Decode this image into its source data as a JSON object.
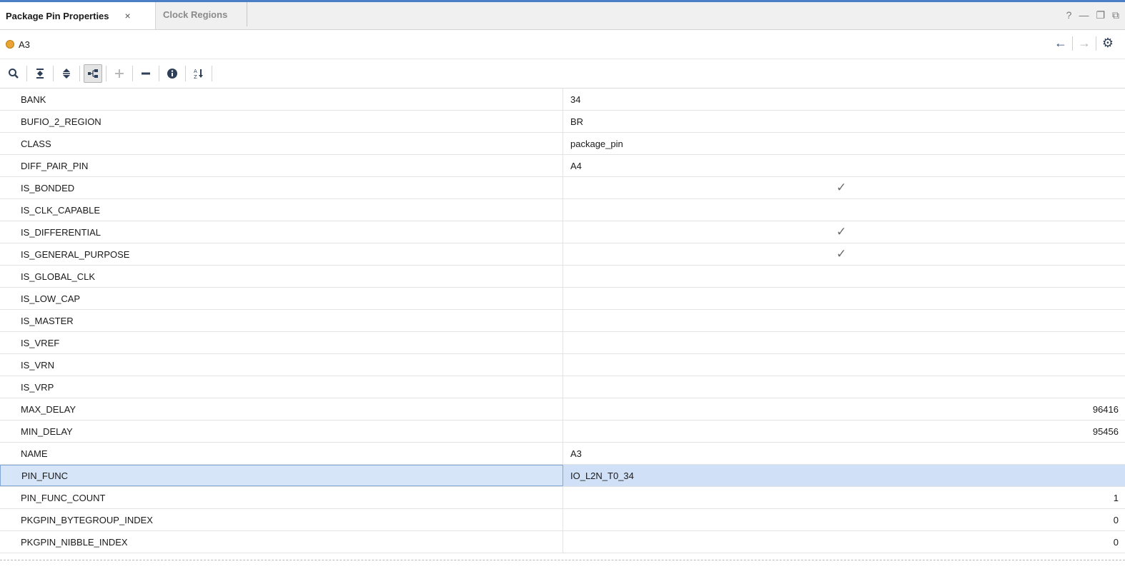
{
  "tabs": [
    {
      "label": "Package Pin Properties",
      "close": "×"
    },
    {
      "label": "Clock Regions"
    }
  ],
  "window_controls": [
    "?",
    "—",
    "❐",
    "⧉"
  ],
  "object": {
    "name": "A3",
    "icon": "pin-icon"
  },
  "nav": {
    "back": "←",
    "forward": "→",
    "settings": "⚙"
  },
  "toolbar": {
    "search": "search-icon",
    "collapse_all": "collapse-all-icon",
    "expand_all": "expand-all-icon",
    "group": "group-icon",
    "add": "plus-icon",
    "remove": "minus-icon",
    "info": "info-icon",
    "sort": "sort-az-icon"
  },
  "properties": [
    {
      "name": "BANK",
      "value": "34",
      "kind": "text"
    },
    {
      "name": "BUFIO_2_REGION",
      "value": "BR",
      "kind": "text"
    },
    {
      "name": "CLASS",
      "value": "package_pin",
      "kind": "text"
    },
    {
      "name": "DIFF_PAIR_PIN",
      "value": "A4",
      "kind": "text"
    },
    {
      "name": "IS_BONDED",
      "value": "✓",
      "kind": "check"
    },
    {
      "name": "IS_CLK_CAPABLE",
      "value": "",
      "kind": "check"
    },
    {
      "name": "IS_DIFFERENTIAL",
      "value": "✓",
      "kind": "check"
    },
    {
      "name": "IS_GENERAL_PURPOSE",
      "value": "✓",
      "kind": "check"
    },
    {
      "name": "IS_GLOBAL_CLK",
      "value": "",
      "kind": "check"
    },
    {
      "name": "IS_LOW_CAP",
      "value": "",
      "kind": "check"
    },
    {
      "name": "IS_MASTER",
      "value": "",
      "kind": "check"
    },
    {
      "name": "IS_VREF",
      "value": "",
      "kind": "check"
    },
    {
      "name": "IS_VRN",
      "value": "",
      "kind": "check"
    },
    {
      "name": "IS_VRP",
      "value": "",
      "kind": "check"
    },
    {
      "name": "MAX_DELAY",
      "value": "96416",
      "kind": "num"
    },
    {
      "name": "MIN_DELAY",
      "value": "95456",
      "kind": "num"
    },
    {
      "name": "NAME",
      "value": "A3",
      "kind": "text"
    },
    {
      "name": "PIN_FUNC",
      "value": "IO_L2N_T0_34",
      "kind": "text",
      "selected": true
    },
    {
      "name": "PIN_FUNC_COUNT",
      "value": "1",
      "kind": "num"
    },
    {
      "name": "PKGPIN_BYTEGROUP_INDEX",
      "value": "0",
      "kind": "num"
    },
    {
      "name": "PKGPIN_NIBBLE_INDEX",
      "value": "0",
      "kind": "num"
    }
  ],
  "colors": {
    "accent": "#4a7fc7",
    "selected_row": "#cfe0f7"
  }
}
